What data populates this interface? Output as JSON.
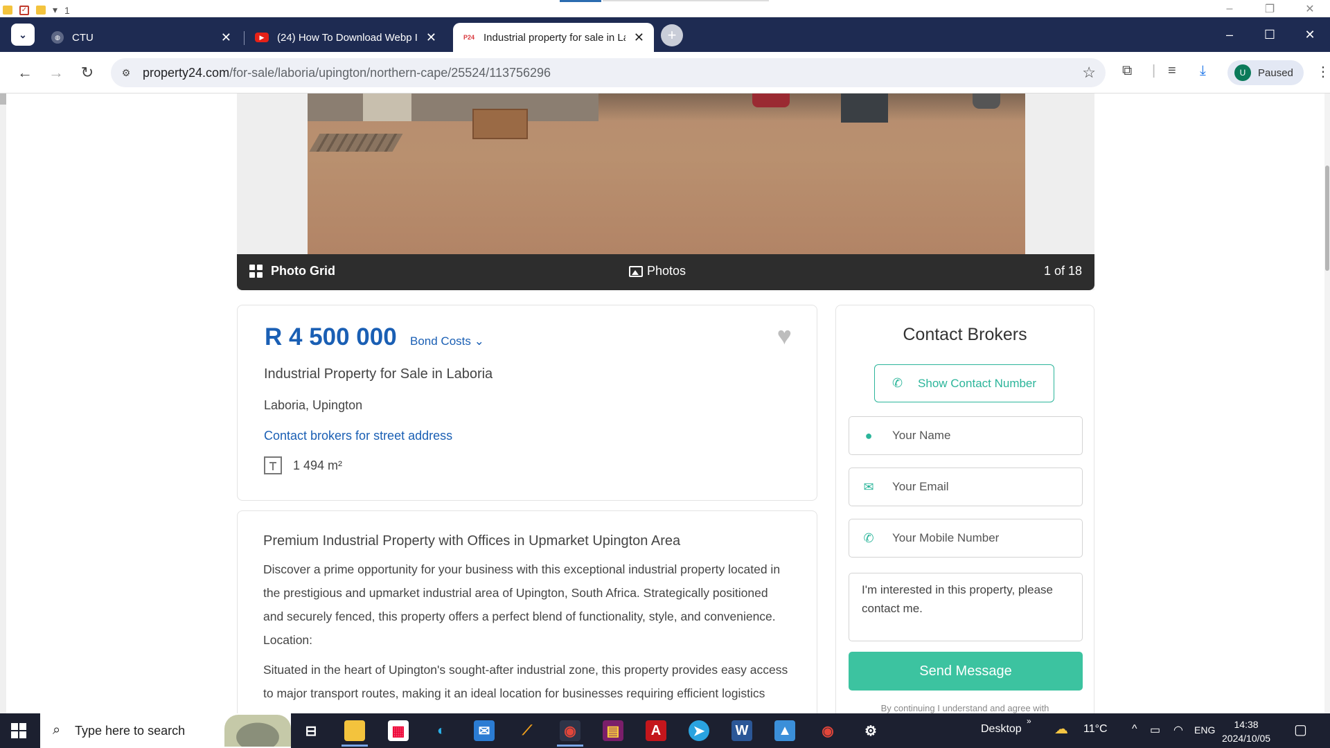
{
  "window": {
    "quick_access_number": "1"
  },
  "tabs": [
    {
      "title": "CTU",
      "icon": "globe-icon",
      "active": false
    },
    {
      "title": "(24) How To Download Webp In",
      "icon": "youtube-icon",
      "active": false
    },
    {
      "title": "Industrial property for sale in La",
      "icon": "p24-icon",
      "active": true
    }
  ],
  "tab_icon_text": {
    "p24": "P24"
  },
  "address_bar": {
    "url_domain": "property24.com",
    "url_path": "/for-sale/laboria/upington/northern-cape/25524/113756296"
  },
  "profile": {
    "initial": "U",
    "status": "Paused"
  },
  "gallery": {
    "photo_grid_label": "Photo Grid",
    "photos_label": "Photos",
    "counter": "1 of 18"
  },
  "listing": {
    "price": "R 4 500 000",
    "bond_costs_label": "Bond Costs",
    "title": "Industrial Property for Sale in Laboria",
    "location": "Laboria, Upington",
    "street_link": "Contact brokers for street address",
    "size": "1 494 m²"
  },
  "description": {
    "heading": "Premium Industrial Property with Offices in Upmarket Upington Area",
    "p1_line1": "Discover a prime opportunity for your business with this exceptional industrial property located in",
    "p1_line2": "the prestigious and upmarket industrial area of Upington, South Africa. Strategically positioned",
    "p1_line3": "and securely fenced, this property offers a perfect blend of functionality, style, and convenience.",
    "location_label": "Location:",
    "p2_line1": "Situated in the heart of Upington's sought-after industrial zone, this property provides easy access",
    "p2_line2": "to major transport routes, making it an ideal location for businesses requiring efficient logistics"
  },
  "contact": {
    "title": "Contact Brokers",
    "show_number_label": "Show Contact Number",
    "name_placeholder": "Your Name",
    "email_placeholder": "Your Email",
    "mobile_placeholder": "Your Mobile Number",
    "message_line1": "I'm interested in this property, please",
    "message_line2": "contact me.",
    "send_label": "Send Message",
    "terms_text": "By continuing I understand and agree with"
  },
  "taskbar": {
    "search_placeholder": "Type here to search",
    "desktop_label": "Desktop",
    "temperature": "11°C",
    "language": "ENG",
    "time": "14:38",
    "date": "2024/10/05"
  },
  "colors": {
    "tabbar": "#1e2b52",
    "price_blue": "#1a5fb4",
    "accent_green": "#3cc3a0",
    "taskbar": "#1c2030"
  }
}
